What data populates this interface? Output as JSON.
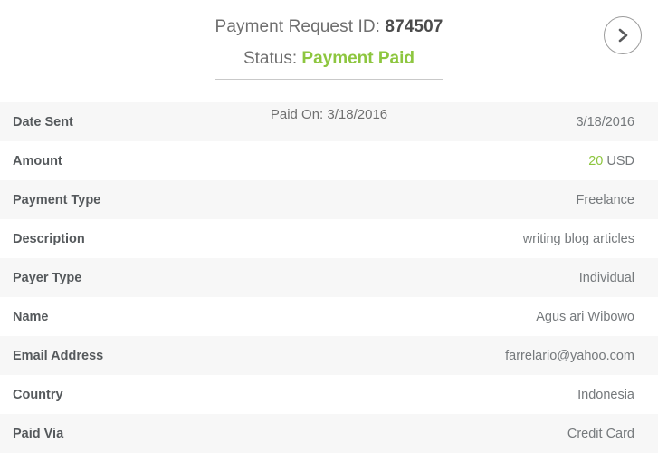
{
  "header": {
    "title_prefix": "Payment Request ID:",
    "request_id": "874507",
    "status_prefix": "Status:",
    "status_value": "Payment Paid",
    "paid_on": "Paid On: 3/18/2016",
    "next_button_label": "Next payment request",
    "next_icon": "chevron-right-icon",
    "status_color": "#8dc63f",
    "title_color": "#6f6f6f"
  },
  "details": {
    "rows": [
      {
        "label": "Date Sent",
        "value": "3/18/2016"
      },
      {
        "label": "Amount",
        "value": "20 USD",
        "amount": "20",
        "currency": "USD"
      },
      {
        "label": "Payment Type",
        "value": "Freelance"
      },
      {
        "label": "Description",
        "value": "writing blog articles"
      },
      {
        "label": "Payer Type",
        "value": "Individual"
      },
      {
        "label": "Name",
        "value": "Agus ari Wibowo"
      },
      {
        "label": "Email Address",
        "value": "farrelario@yahoo.com"
      },
      {
        "label": "Country",
        "value": "Indonesia"
      },
      {
        "label": "Paid Via",
        "value": "Credit Card"
      }
    ]
  }
}
